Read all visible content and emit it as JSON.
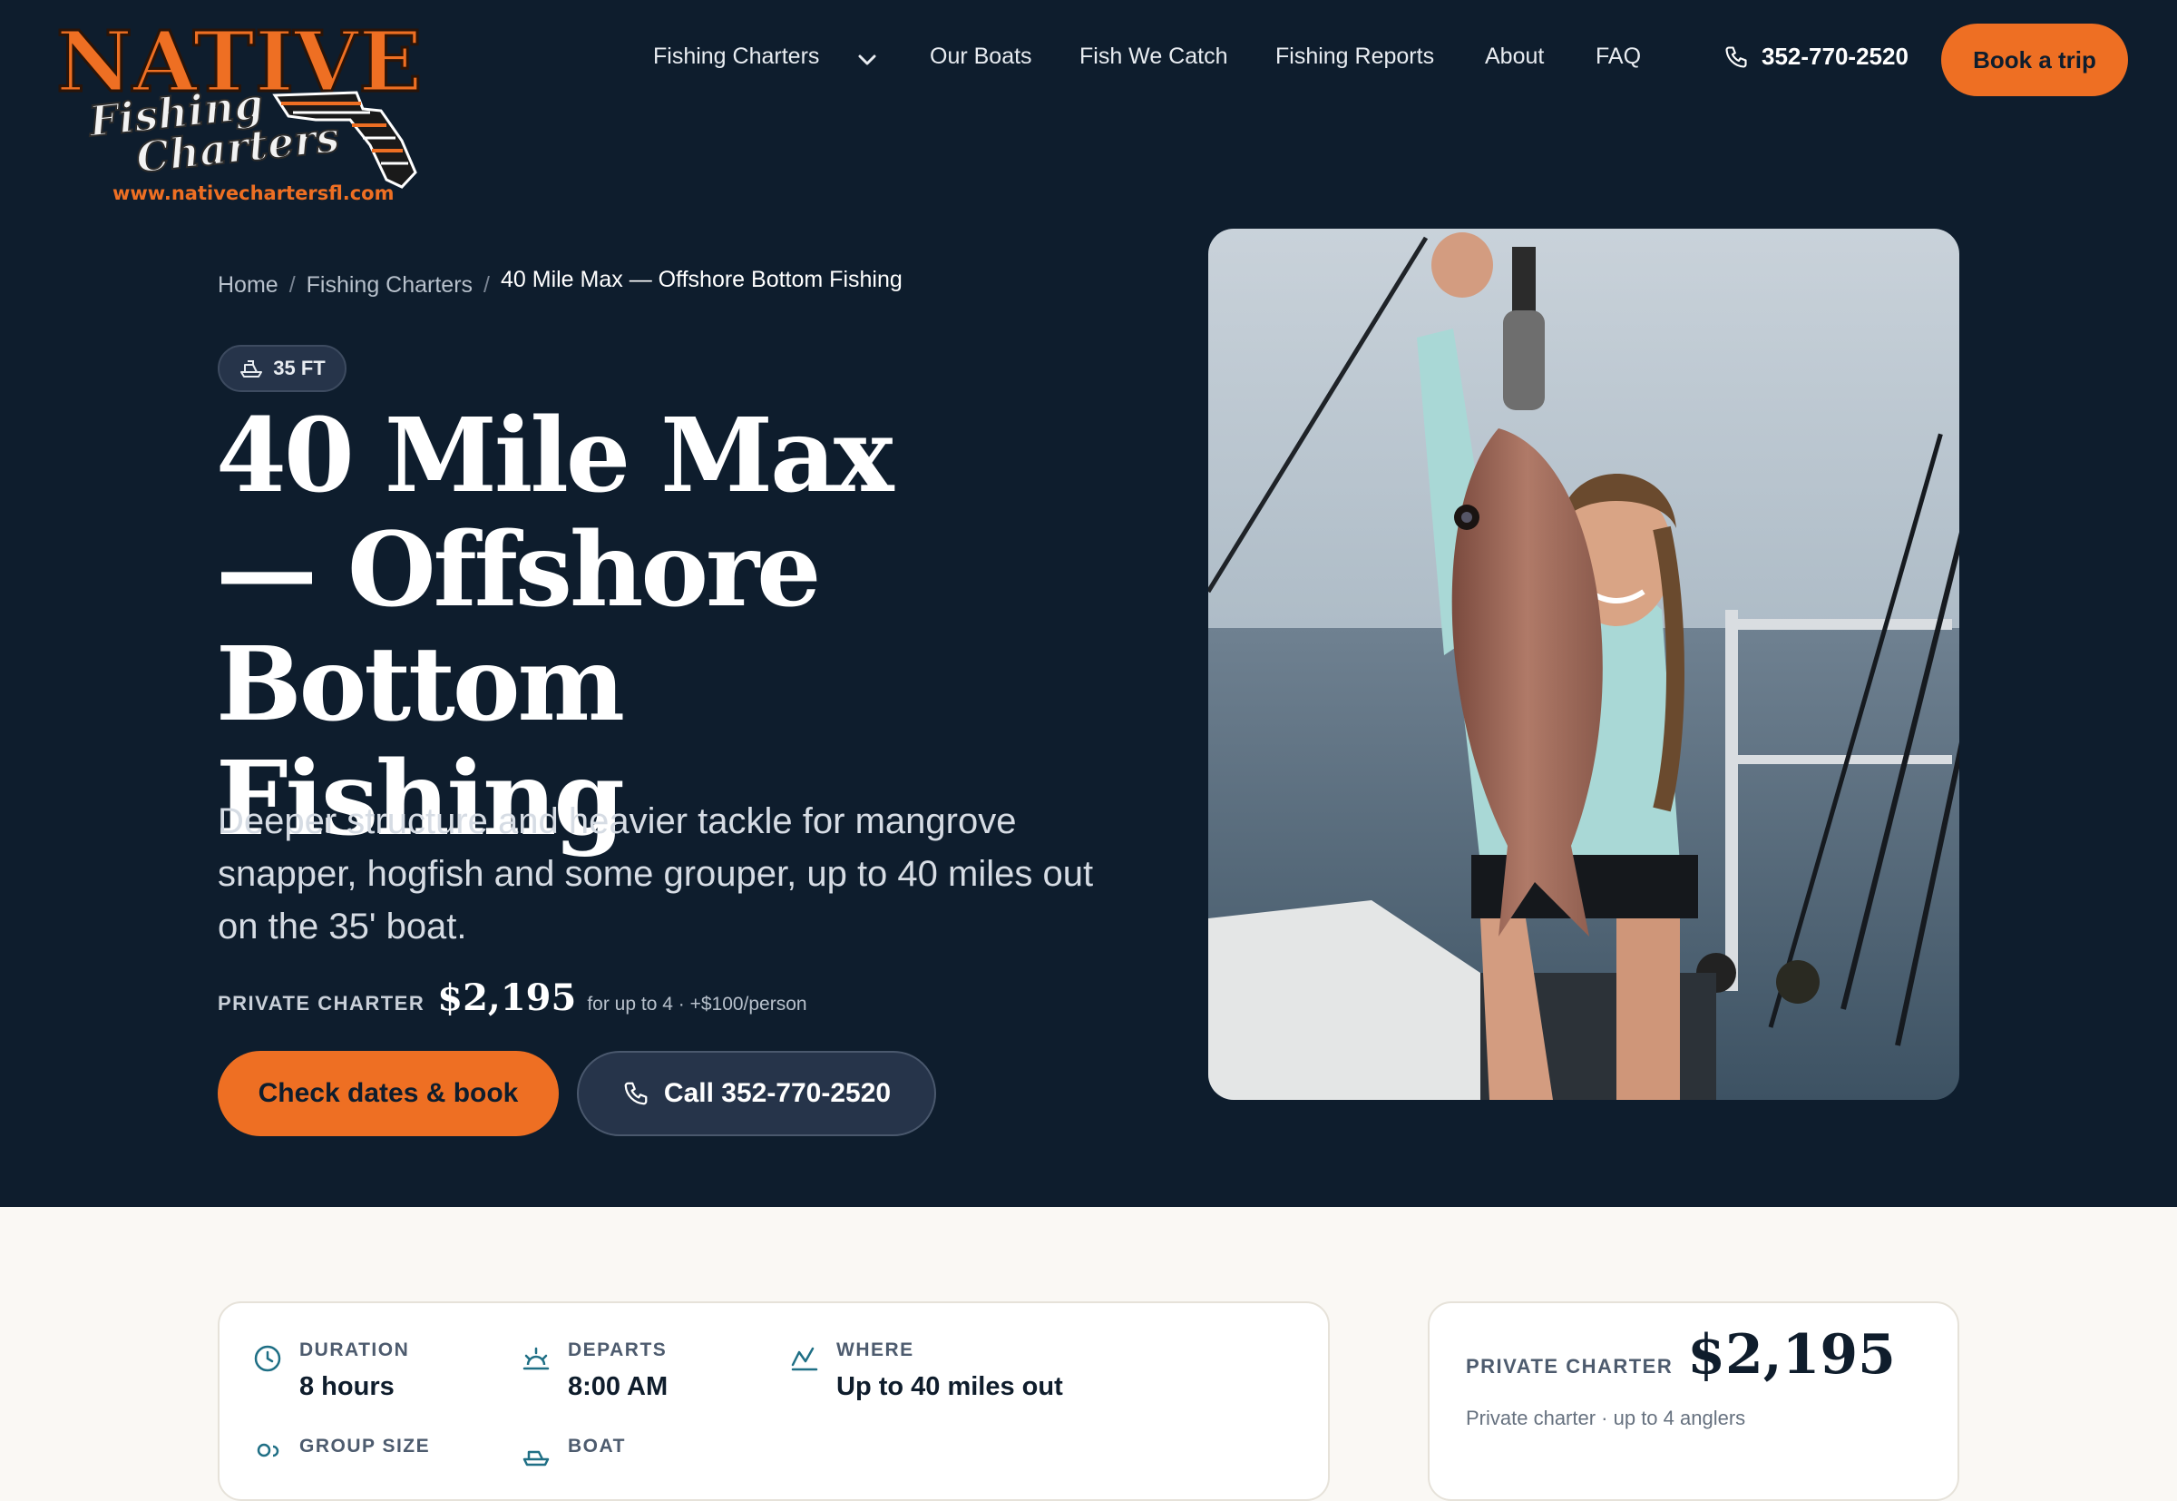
{
  "logo": {
    "line1": "NATIVE",
    "line2": "Fishing",
    "line3": "Charters",
    "url": "www.nativechartersfl.com"
  },
  "nav": {
    "items": [
      "Fishing Charters",
      "Our Boats",
      "Fish We Catch",
      "Fishing Reports",
      "About",
      "FAQ"
    ],
    "phone": "352-770-2520",
    "book_label": "Book a trip"
  },
  "breadcrumb": {
    "home": "Home",
    "section": "Fishing Charters",
    "current": "40 Mile Max — Offshore Bottom Fishing"
  },
  "badge": {
    "label": "35 FT",
    "icon": "boat-icon"
  },
  "hero": {
    "title_line1": "40 Mile Max",
    "title_line2": "— Offshore",
    "title_line3": "Bottom Fishing",
    "description": "Deeper structure and heavier tackle for mangrove snapper, hogfish and some grouper, up to 40 miles out on the 35' boat.",
    "price_label": "PRIVATE CHARTER",
    "price": "$2,195",
    "price_note": "for up to 4 · +$100/person",
    "primary_cta": "Check dates & book",
    "secondary_cta": "Call 352-770-2520"
  },
  "details": {
    "duration": {
      "label": "DURATION",
      "value": "8 hours",
      "icon": "clock-icon"
    },
    "departs": {
      "label": "DEPARTS",
      "value": "8:00 AM",
      "icon": "sunrise-icon"
    },
    "where": {
      "label": "WHERE",
      "value": "Up to 40 miles out",
      "icon": "route-icon"
    },
    "group_size": {
      "label": "GROUP SIZE",
      "icon": "group-icon"
    },
    "boat": {
      "label": "BOAT",
      "icon": "boat-icon"
    }
  },
  "price_card": {
    "label": "PRIVATE CHARTER",
    "price": "$2,195",
    "note": "Private charter · up to 4 anglers"
  },
  "colors": {
    "navy": "#0e1d2d",
    "accent": "#ee6f23",
    "cream": "#faf8f4"
  }
}
